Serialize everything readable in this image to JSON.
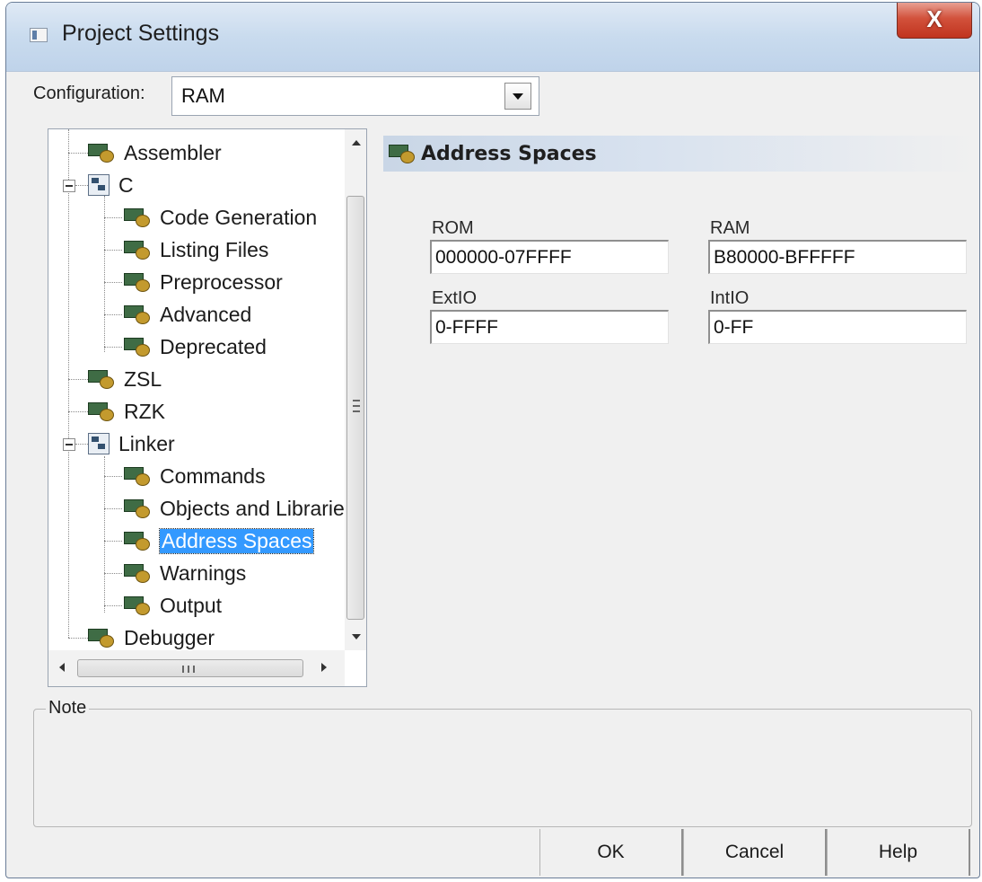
{
  "window": {
    "title": "Project Settings",
    "close_glyph": "X"
  },
  "config": {
    "label": "Configuration:",
    "value": "RAM"
  },
  "tree": {
    "items": [
      {
        "label": "Assembler"
      },
      {
        "label": "C"
      },
      {
        "label": "Code Generation"
      },
      {
        "label": "Listing Files"
      },
      {
        "label": "Preprocessor"
      },
      {
        "label": "Advanced"
      },
      {
        "label": "Deprecated"
      },
      {
        "label": "ZSL"
      },
      {
        "label": "RZK"
      },
      {
        "label": "Linker"
      },
      {
        "label": "Commands"
      },
      {
        "label": "Objects and Librarie"
      },
      {
        "label": "Address Spaces",
        "selected": true
      },
      {
        "label": "Warnings"
      },
      {
        "label": "Output"
      },
      {
        "label": "Debugger"
      }
    ]
  },
  "panel": {
    "title": "Address Spaces",
    "rom_label": "ROM",
    "rom_value": "000000-07FFFF",
    "ram_label": "RAM",
    "ram_value": "B80000-BFFFFF",
    "extio_label": "ExtIO",
    "extio_value": "0-FFFF",
    "intio_label": "IntIO",
    "intio_value": "0-FF"
  },
  "note": {
    "label": "Note"
  },
  "buttons": {
    "ok": "OK",
    "cancel": "Cancel",
    "help": "Help"
  },
  "colors": {
    "selection": "#3399ff",
    "close_button": "#c0341f"
  }
}
